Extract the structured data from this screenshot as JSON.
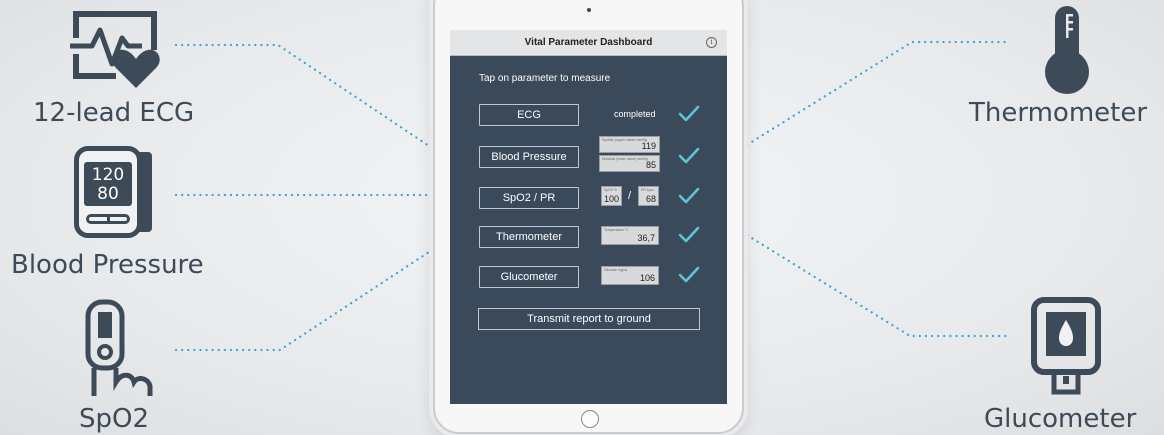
{
  "devices": {
    "ecg": "12-lead ECG",
    "bp": "Blood Pressure",
    "spo2": "SpO2",
    "thermo": "Thermometer",
    "gluco": "Glucometer"
  },
  "bp_display": {
    "sys": "120",
    "dia": "80"
  },
  "app": {
    "title": "Vital Parameter Dashboard",
    "instruction": "Tap on parameter to measure",
    "params": {
      "ecg": {
        "label": "ECG",
        "status": "completed"
      },
      "bp": {
        "label": "Blood Pressure",
        "sys_caption": "Systolic (upper value) mmHg",
        "sys": "119",
        "dia_caption": "Diastolic (lower value) mmHg",
        "dia": "85"
      },
      "spo2": {
        "label": "SpO2 / PR",
        "spo2_caption": "SpO2 %",
        "spo2": "100",
        "slash": "/",
        "pr_caption": "PR bpm",
        "pr": "68"
      },
      "thermo": {
        "label": "Thermometer",
        "caption": "Temperature °C",
        "value": "36,7"
      },
      "gluco": {
        "label": "Glucometer",
        "caption": "Glucose mg/dL",
        "value": "106"
      }
    },
    "transmit": "Transmit report to ground"
  },
  "colors": {
    "screen": "#3b4a5b",
    "check": "#5cc5d3",
    "dots": "#3aa2d8",
    "icon": "#3d4b59"
  }
}
